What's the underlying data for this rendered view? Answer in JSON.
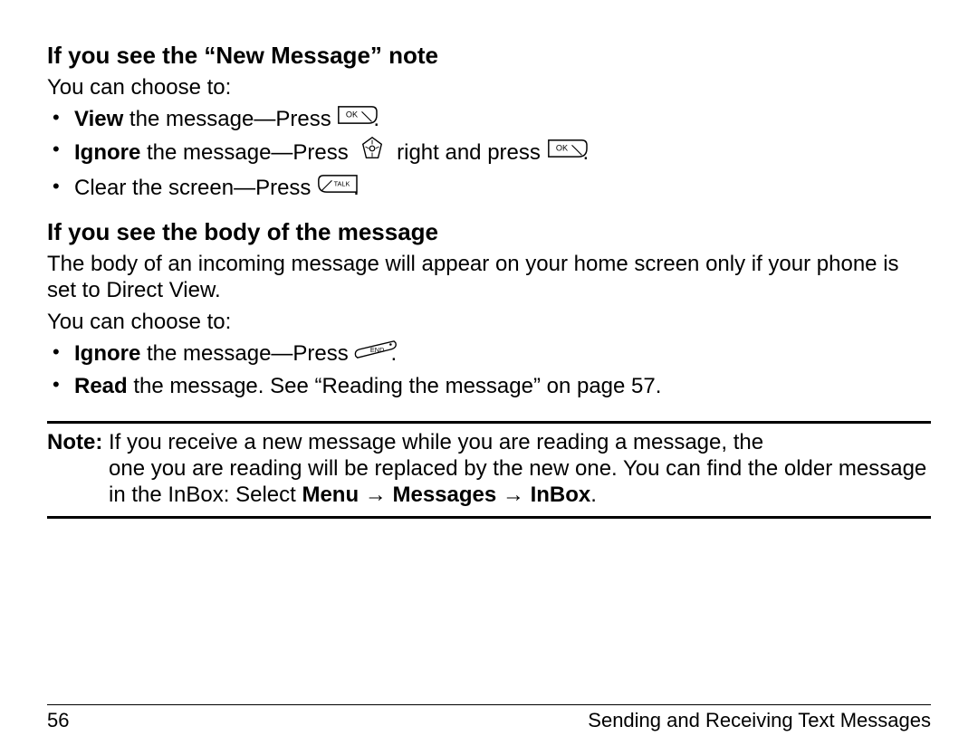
{
  "headings": {
    "h1": "If you see the “New Message” note",
    "h2": "If you see the body of the message"
  },
  "intro": {
    "choose1": "You can choose to:",
    "choose2": "You can choose to:"
  },
  "bullets1": {
    "view_bold": "View",
    "view_rest": " the message—Press ",
    "ignore_bold": "Ignore",
    "ignore_rest": " the message—Press ",
    "ignore_rest2": " right and press ",
    "clear": "Clear the screen—Press "
  },
  "body_para": "The body of an incoming message will appear on your home screen only if your phone is set to Direct View.",
  "bullets2": {
    "ignore_bold": "Ignore",
    "ignore_rest": " the message—Press ",
    "read_bold": "Read",
    "read_rest": " the message. See “Reading the message” on page 57."
  },
  "note": {
    "label": "Note:",
    "line1": "If you receive a new message while you are reading a message, the ",
    "line2": "one you are reading will be replaced by the new one. You can find the older message in the InBox: Select ",
    "menu": "Menu",
    "arrow": " → ",
    "messages": "Messages",
    "inbox": "InBox",
    "period": "."
  },
  "footer": {
    "page": "56",
    "chapter": "Sending and Receiving Text Messages"
  },
  "icons": {
    "ok": "OK",
    "talk": "TALK",
    "end": "END"
  },
  "punct": {
    "p": "."
  }
}
